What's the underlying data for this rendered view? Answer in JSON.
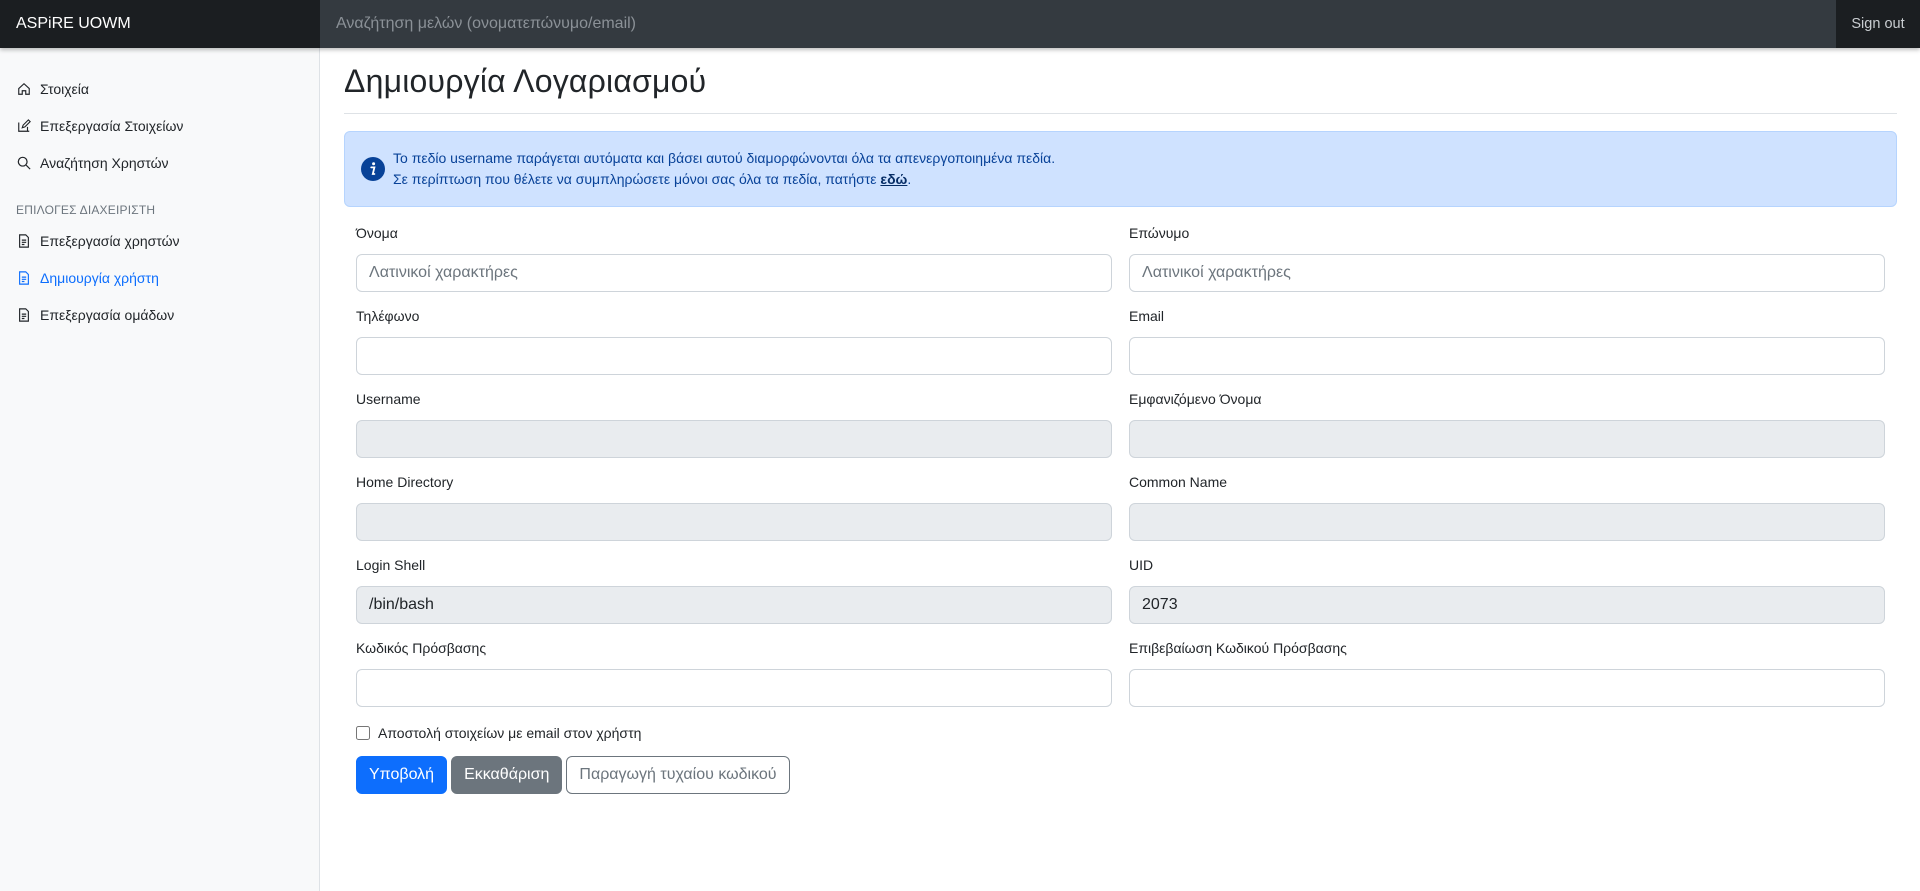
{
  "navbar": {
    "brand": "ASPiRE UOWM",
    "search_placeholder": "Αναζήτηση μελών (ονοματεπώνυμο/email)",
    "signout_label": "Sign out"
  },
  "sidebar": {
    "items": [
      {
        "label": "Στοιχεία",
        "icon": "home-icon"
      },
      {
        "label": "Επεξεργασία Στοιχείων",
        "icon": "edit-icon"
      },
      {
        "label": "Αναζήτηση Χρηστών",
        "icon": "search-icon"
      }
    ],
    "admin_heading": "ΕΠΙΛΟΓΕΣ ΔΙΑΧΕΙΡΙΣΤΗ",
    "admin_items": [
      {
        "label": "Επεξεργασία χρηστών",
        "icon": "file-icon"
      },
      {
        "label": "Δημιουργία χρήστη",
        "icon": "file-icon",
        "active": true
      },
      {
        "label": "Επεξεργασία ομάδων",
        "icon": "file-icon"
      }
    ]
  },
  "main": {
    "title": "Δημιουργία Λογαριασμού",
    "alert": {
      "line1": "Το πεδίο username παράγεται αυτόματα και βάσει αυτού διαμορφώνονται όλα τα απενεργοποιημένα πεδία.",
      "line2_prefix": "Σε περίπτωση που θέλετε να συμπληρώσετε μόνοι σας όλα τα πεδία, πατήστε ",
      "link": "εδώ",
      "line2_suffix": "."
    },
    "form": {
      "first_name": {
        "label": "Όνομα",
        "placeholder": "Λατινικοί χαρακτήρες",
        "value": ""
      },
      "last_name": {
        "label": "Επώνυμο",
        "placeholder": "Λατινικοί χαρακτήρες",
        "value": ""
      },
      "phone": {
        "label": "Τηλέφωνο",
        "value": ""
      },
      "email": {
        "label": "Email",
        "value": ""
      },
      "username": {
        "label": "Username",
        "value": ""
      },
      "display_name": {
        "label": "Εμφανιζόμενο Όνομα",
        "value": ""
      },
      "home_directory": {
        "label": "Home Directory",
        "value": ""
      },
      "common_name": {
        "label": "Common Name",
        "value": ""
      },
      "login_shell": {
        "label": "Login Shell",
        "value": "/bin/bash"
      },
      "uid": {
        "label": "UID",
        "value": "2073"
      },
      "password": {
        "label": "Κωδικός Πρόσβασης",
        "value": ""
      },
      "password_confirm": {
        "label": "Επιβεβαίωση Κωδικού Πρόσβασης",
        "value": ""
      },
      "send_email_label": "Αποστολή στοιχείων με email στον χρήστη",
      "send_email_checked": false,
      "submit_label": "Υποβολή",
      "clear_label": "Εκκαθάριση",
      "generate_password_label": "Παραγωγή τυχαίου κωδικού"
    }
  }
}
